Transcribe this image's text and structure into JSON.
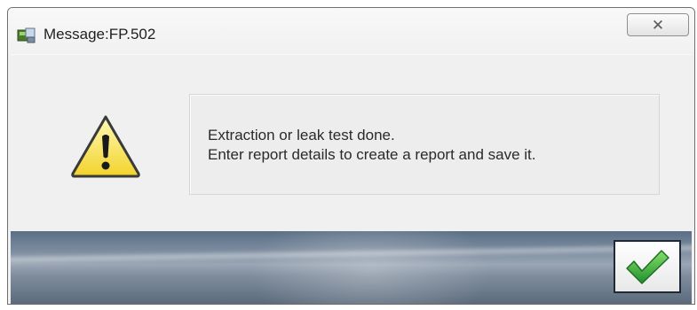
{
  "window": {
    "title": "Message:FP.502",
    "close_glyph": "✕",
    "app_icon": "app-icon",
    "close_icon": "close-icon"
  },
  "content": {
    "icon": "warning-icon",
    "message_lines": [
      "Extraction or leak test done.",
      "Enter report details to create a report and save it."
    ]
  },
  "footer": {
    "ok_icon": "checkmark-icon",
    "ok_color": "#36b33a"
  }
}
